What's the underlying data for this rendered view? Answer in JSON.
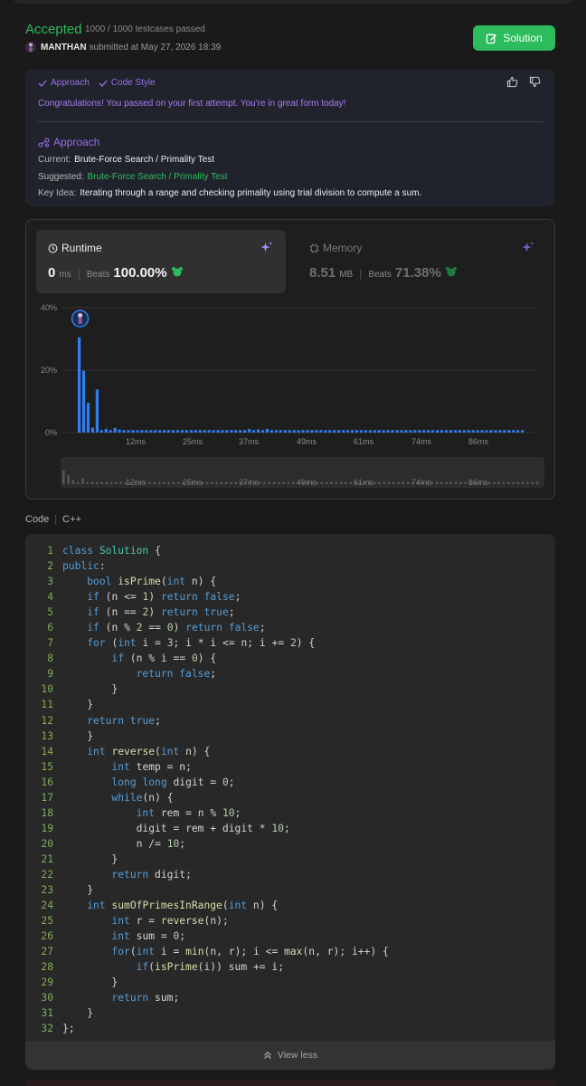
{
  "header": {
    "status": "Accepted",
    "testcases": "1000 / 1000 testcases passed",
    "username": "MANTHAN",
    "submitted_text": "submitted at May 27, 2026 18:39",
    "solution_label": "Solution"
  },
  "analysis": {
    "tab_approach": "Approach",
    "tab_code_style": "Code Style",
    "congrats": "Congratulations! You passed on your first attempt. You're in great form today!",
    "approach_title": "Approach",
    "current_label": "Current:",
    "current_value": "Brute-Force Search  /  Primality Test",
    "suggested_label": "Suggested:",
    "suggested_value": "Brute-Force Search  /  Primality Test",
    "key_idea_label": "Key Idea:",
    "key_idea_value": "Iterating through a range and checking primality using trial division to compute a sum."
  },
  "performance": {
    "runtime_title": "Runtime",
    "runtime_value": "0",
    "runtime_unit": "ms",
    "runtime_beats_label": "Beats",
    "runtime_beats": "100.00%",
    "memory_title": "Memory",
    "memory_value": "8.51",
    "memory_unit": "MB",
    "memory_beats_label": "Beats",
    "memory_beats": "71.38%"
  },
  "chart_data": {
    "type": "bar",
    "y_ticks": [
      "40%",
      "20%",
      "0%"
    ],
    "ylim": [
      0,
      40
    ],
    "x_ticks": [
      "12ms",
      "25ms",
      "37ms",
      "49ms",
      "61ms",
      "74ms",
      "86ms"
    ],
    "values": [
      30.5,
      19.8,
      9.5,
      1.6,
      13.8,
      0.8,
      1.2,
      0.8,
      1.5,
      1.0,
      0.8,
      0.8,
      0.8,
      0.8,
      0.8,
      0.8,
      0.8,
      0.8,
      0.8,
      0.8,
      0.8,
      0.8,
      0.8,
      0.8,
      0.8,
      0.8,
      0.8,
      0.8,
      0.8,
      0.8,
      0.8,
      0.8,
      0.8,
      0.8,
      0.8,
      0.8,
      0.8,
      0.8,
      1.2,
      0.8,
      1.0,
      0.8,
      1.2,
      0.8,
      0.8,
      0.8,
      0.8,
      0.8,
      0.8,
      0.8,
      0.8,
      0.8,
      0.8,
      0.8,
      0.8,
      0.8,
      0.8,
      0.8,
      0.8,
      0.8,
      0.8,
      0.8,
      0.8,
      0.8,
      0.8,
      0.8,
      0.8,
      0.8,
      0.8,
      0.8,
      0.8,
      0.8,
      0.8,
      0.8,
      0.8,
      0.8,
      0.8,
      0.8,
      0.8,
      0.8,
      0.8,
      0.8,
      0.8,
      0.8,
      0.8,
      0.8,
      0.8,
      0.8,
      0.8,
      0.8,
      0.8,
      0.8,
      0.8,
      0.8,
      0.8,
      0.8,
      0.8,
      0.8,
      0.8,
      0.8
    ],
    "highlight_index": 0,
    "bar_color": "#2f7ff2"
  },
  "code": {
    "label": "Code",
    "language": "C++",
    "view_less": "View less",
    "lines": [
      "class Solution {",
      "public:",
      "    bool isPrime(int n) {",
      "    if (n <= 1) return false;",
      "    if (n == 2) return true;",
      "    if (n % 2 == 0) return false;",
      "    for (int i = 3; i * i <= n; i += 2) {",
      "        if (n % i == 0) {",
      "            return false;",
      "        }",
      "    }",
      "    return true;",
      "    }",
      "    int reverse(int n) {",
      "        int temp = n;",
      "        long long digit = 0;",
      "        while(n) {",
      "            int rem = n % 10;",
      "            digit = rem + digit * 10;",
      "            n /= 10;",
      "        }",
      "        return digit;",
      "    }",
      "    int sumOfPrimesInRange(int n) {",
      "        int r = reverse(n);",
      "        int sum = 0;",
      "        for(int i = min(n, r); i <= max(n, r); i++) {",
      "            if(isPrime(i)) sum += i;",
      "        }",
      "        return sum;",
      "    }",
      "};"
    ]
  }
}
